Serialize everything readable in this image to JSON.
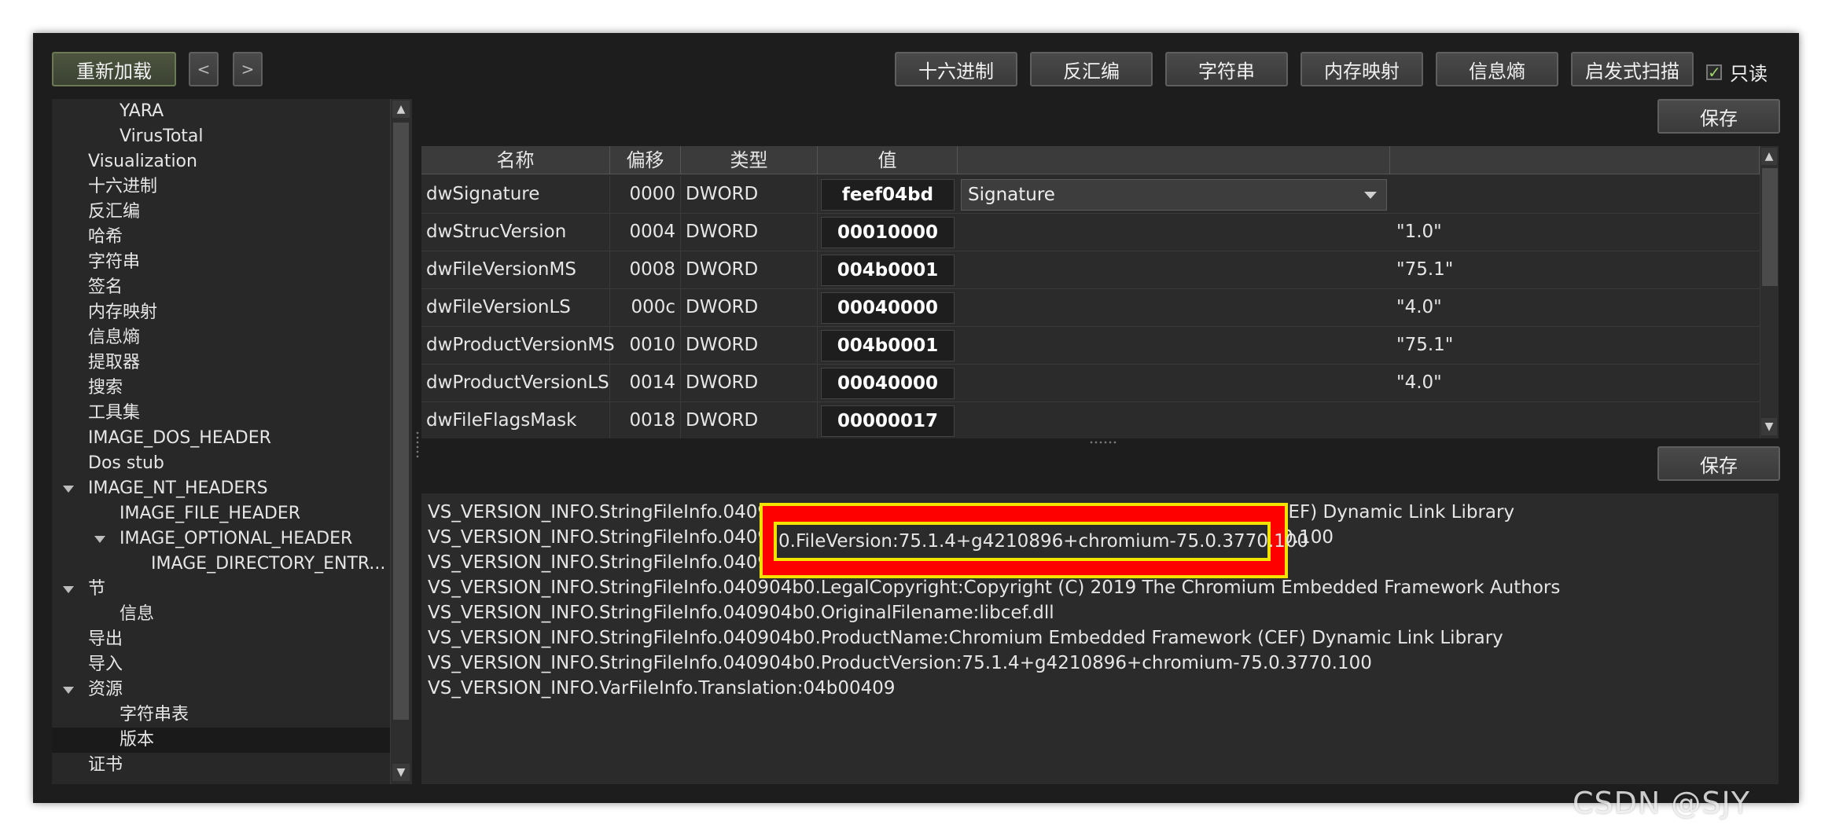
{
  "toolbar": {
    "reload_label": "重新加载",
    "back_label": "<",
    "forward_label": ">",
    "tabs": [
      "十六进制",
      "反汇编",
      "字符串",
      "内存映射",
      "信息熵",
      "启发式扫描"
    ],
    "readonly_label": "只读",
    "readonly_checked_mark": "✓"
  },
  "save_label": "保存",
  "tree": {
    "items": [
      {
        "label": "YARA"
      },
      {
        "label": "VirusTotal"
      },
      {
        "label": "Visualization"
      },
      {
        "label": "十六进制"
      },
      {
        "label": "反汇编"
      },
      {
        "label": "哈希"
      },
      {
        "label": "字符串"
      },
      {
        "label": "签名"
      },
      {
        "label": "内存映射"
      },
      {
        "label": "信息熵"
      },
      {
        "label": "提取器"
      },
      {
        "label": "搜索"
      },
      {
        "label": "工具集"
      },
      {
        "label": "IMAGE_DOS_HEADER"
      },
      {
        "label": "Dos stub"
      },
      {
        "label": "IMAGE_NT_HEADERS"
      },
      {
        "label": "IMAGE_FILE_HEADER"
      },
      {
        "label": "IMAGE_OPTIONAL_HEADER"
      },
      {
        "label": "IMAGE_DIRECTORY_ENTR..."
      },
      {
        "label": "节"
      },
      {
        "label": "信息"
      },
      {
        "label": "导出"
      },
      {
        "label": "导入"
      },
      {
        "label": "资源"
      },
      {
        "label": "字符串表"
      },
      {
        "label": "版本"
      },
      {
        "label": "证书"
      }
    ]
  },
  "table": {
    "columns": [
      "名称",
      "偏移",
      "类型",
      "值",
      "",
      ""
    ],
    "rows": [
      {
        "name": "dwSignature",
        "offset": "0000",
        "type": "DWORD",
        "value": "feef04bd",
        "combo": "Signature",
        "extra": ""
      },
      {
        "name": "dwStrucVersion",
        "offset": "0004",
        "type": "DWORD",
        "value": "00010000",
        "combo": "",
        "extra": "\"1.0\""
      },
      {
        "name": "dwFileVersionMS",
        "offset": "0008",
        "type": "DWORD",
        "value": "004b0001",
        "combo": "",
        "extra": "\"75.1\""
      },
      {
        "name": "dwFileVersionLS",
        "offset": "000c",
        "type": "DWORD",
        "value": "00040000",
        "combo": "",
        "extra": "\"4.0\""
      },
      {
        "name": "dwProductVersionMS",
        "offset": "0010",
        "type": "DWORD",
        "value": "004b0001",
        "combo": "",
        "extra": "\"75.1\""
      },
      {
        "name": "dwProductVersionLS",
        "offset": "0014",
        "type": "DWORD",
        "value": "00040000",
        "combo": "",
        "extra": "\"4.0\""
      },
      {
        "name": "dwFileFlagsMask",
        "offset": "0018",
        "type": "DWORD",
        "value": "00000017",
        "combo": "",
        "extra": ""
      }
    ]
  },
  "strings": {
    "lines": [
      "VS_VERSION_INFO.StringFileInfo.040904b0.FileDescription:Chromium Embedded Framework (CEF) Dynamic Link Library",
      "VS_VERSION_INFO.StringFileInfo.040904b0.FileVersion:75.1.4+g4210896+chromium-75.0.3770.100",
      "VS_VERSION_INFO.StringFileInfo.040904b0.InternalName:libcef",
      "VS_VERSION_INFO.StringFileInfo.040904b0.LegalCopyright:Copyright (C) 2019 The Chromium Embedded Framework Authors",
      "VS_VERSION_INFO.StringFileInfo.040904b0.OriginalFilename:libcef.dll",
      "VS_VERSION_INFO.StringFileInfo.040904b0.ProductName:Chromium Embedded Framework (CEF) Dynamic Link Library",
      "VS_VERSION_INFO.StringFileInfo.040904b0.ProductVersion:75.1.4+g4210896+chromium-75.0.3770.100",
      "VS_VERSION_INFO.VarFileInfo.Translation:04b00409"
    ],
    "highlight_text": "0.FileVersion:75.1.4+g4210896+chromium-75.0.3770.100"
  },
  "watermark": "CSDN @SJY",
  "colors": {
    "highlight_border": "#f2e300",
    "highlight_fill": "#ff0000",
    "checkbox_mark": "#9fd36b"
  }
}
